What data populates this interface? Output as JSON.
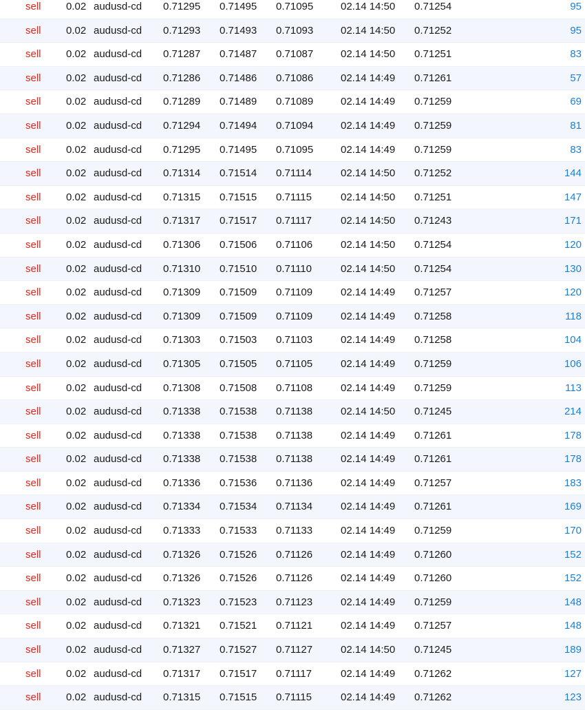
{
  "colors": {
    "sell_text": "#e0281e",
    "profit_text": "#1e7fd1",
    "row_alt_bg": "#f3f7fd",
    "row_bg": "#ffffff"
  },
  "orders": [
    {
      "side": "sell",
      "volume": "0.02",
      "symbol": "audusd-cd",
      "open_price": "0.71295",
      "take_profit": "0.71495",
      "stop_loss": "0.71095",
      "time": "02.14 14:50",
      "current_price": "0.71254",
      "profit": "95"
    },
    {
      "side": "sell",
      "volume": "0.02",
      "symbol": "audusd-cd",
      "open_price": "0.71293",
      "take_profit": "0.71493",
      "stop_loss": "0.71093",
      "time": "02.14 14:50",
      "current_price": "0.71252",
      "profit": "95"
    },
    {
      "side": "sell",
      "volume": "0.02",
      "symbol": "audusd-cd",
      "open_price": "0.71287",
      "take_profit": "0.71487",
      "stop_loss": "0.71087",
      "time": "02.14 14:50",
      "current_price": "0.71251",
      "profit": "83"
    },
    {
      "side": "sell",
      "volume": "0.02",
      "symbol": "audusd-cd",
      "open_price": "0.71286",
      "take_profit": "0.71486",
      "stop_loss": "0.71086",
      "time": "02.14 14:49",
      "current_price": "0.71261",
      "profit": "57"
    },
    {
      "side": "sell",
      "volume": "0.02",
      "symbol": "audusd-cd",
      "open_price": "0.71289",
      "take_profit": "0.71489",
      "stop_loss": "0.71089",
      "time": "02.14 14:49",
      "current_price": "0.71259",
      "profit": "69"
    },
    {
      "side": "sell",
      "volume": "0.02",
      "symbol": "audusd-cd",
      "open_price": "0.71294",
      "take_profit": "0.71494",
      "stop_loss": "0.71094",
      "time": "02.14 14:49",
      "current_price": "0.71259",
      "profit": "81"
    },
    {
      "side": "sell",
      "volume": "0.02",
      "symbol": "audusd-cd",
      "open_price": "0.71295",
      "take_profit": "0.71495",
      "stop_loss": "0.71095",
      "time": "02.14 14:49",
      "current_price": "0.71259",
      "profit": "83"
    },
    {
      "side": "sell",
      "volume": "0.02",
      "symbol": "audusd-cd",
      "open_price": "0.71314",
      "take_profit": "0.71514",
      "stop_loss": "0.71114",
      "time": "02.14 14:50",
      "current_price": "0.71252",
      "profit": "144"
    },
    {
      "side": "sell",
      "volume": "0.02",
      "symbol": "audusd-cd",
      "open_price": "0.71315",
      "take_profit": "0.71515",
      "stop_loss": "0.71115",
      "time": "02.14 14:50",
      "current_price": "0.71251",
      "profit": "147"
    },
    {
      "side": "sell",
      "volume": "0.02",
      "symbol": "audusd-cd",
      "open_price": "0.71317",
      "take_profit": "0.71517",
      "stop_loss": "0.71117",
      "time": "02.14 14:50",
      "current_price": "0.71243",
      "profit": "171"
    },
    {
      "side": "sell",
      "volume": "0.02",
      "symbol": "audusd-cd",
      "open_price": "0.71306",
      "take_profit": "0.71506",
      "stop_loss": "0.71106",
      "time": "02.14 14:50",
      "current_price": "0.71254",
      "profit": "120"
    },
    {
      "side": "sell",
      "volume": "0.02",
      "symbol": "audusd-cd",
      "open_price": "0.71310",
      "take_profit": "0.71510",
      "stop_loss": "0.71110",
      "time": "02.14 14:50",
      "current_price": "0.71254",
      "profit": "130"
    },
    {
      "side": "sell",
      "volume": "0.02",
      "symbol": "audusd-cd",
      "open_price": "0.71309",
      "take_profit": "0.71509",
      "stop_loss": "0.71109",
      "time": "02.14 14:49",
      "current_price": "0.71257",
      "profit": "120"
    },
    {
      "side": "sell",
      "volume": "0.02",
      "symbol": "audusd-cd",
      "open_price": "0.71309",
      "take_profit": "0.71509",
      "stop_loss": "0.71109",
      "time": "02.14 14:49",
      "current_price": "0.71258",
      "profit": "118"
    },
    {
      "side": "sell",
      "volume": "0.02",
      "symbol": "audusd-cd",
      "open_price": "0.71303",
      "take_profit": "0.71503",
      "stop_loss": "0.71103",
      "time": "02.14 14:49",
      "current_price": "0.71258",
      "profit": "104"
    },
    {
      "side": "sell",
      "volume": "0.02",
      "symbol": "audusd-cd",
      "open_price": "0.71305",
      "take_profit": "0.71505",
      "stop_loss": "0.71105",
      "time": "02.14 14:49",
      "current_price": "0.71259",
      "profit": "106"
    },
    {
      "side": "sell",
      "volume": "0.02",
      "symbol": "audusd-cd",
      "open_price": "0.71308",
      "take_profit": "0.71508",
      "stop_loss": "0.71108",
      "time": "02.14 14:49",
      "current_price": "0.71259",
      "profit": "113"
    },
    {
      "side": "sell",
      "volume": "0.02",
      "symbol": "audusd-cd",
      "open_price": "0.71338",
      "take_profit": "0.71538",
      "stop_loss": "0.71138",
      "time": "02.14 14:50",
      "current_price": "0.71245",
      "profit": "214"
    },
    {
      "side": "sell",
      "volume": "0.02",
      "symbol": "audusd-cd",
      "open_price": "0.71338",
      "take_profit": "0.71538",
      "stop_loss": "0.71138",
      "time": "02.14 14:49",
      "current_price": "0.71261",
      "profit": "178"
    },
    {
      "side": "sell",
      "volume": "0.02",
      "symbol": "audusd-cd",
      "open_price": "0.71338",
      "take_profit": "0.71538",
      "stop_loss": "0.71138",
      "time": "02.14 14:49",
      "current_price": "0.71261",
      "profit": "178"
    },
    {
      "side": "sell",
      "volume": "0.02",
      "symbol": "audusd-cd",
      "open_price": "0.71336",
      "take_profit": "0.71536",
      "stop_loss": "0.71136",
      "time": "02.14 14:49",
      "current_price": "0.71257",
      "profit": "183"
    },
    {
      "side": "sell",
      "volume": "0.02",
      "symbol": "audusd-cd",
      "open_price": "0.71334",
      "take_profit": "0.71534",
      "stop_loss": "0.71134",
      "time": "02.14 14:49",
      "current_price": "0.71261",
      "profit": "169"
    },
    {
      "side": "sell",
      "volume": "0.02",
      "symbol": "audusd-cd",
      "open_price": "0.71333",
      "take_profit": "0.71533",
      "stop_loss": "0.71133",
      "time": "02.14 14:49",
      "current_price": "0.71259",
      "profit": "170"
    },
    {
      "side": "sell",
      "volume": "0.02",
      "symbol": "audusd-cd",
      "open_price": "0.71326",
      "take_profit": "0.71526",
      "stop_loss": "0.71126",
      "time": "02.14 14:49",
      "current_price": "0.71260",
      "profit": "152"
    },
    {
      "side": "sell",
      "volume": "0.02",
      "symbol": "audusd-cd",
      "open_price": "0.71326",
      "take_profit": "0.71526",
      "stop_loss": "0.71126",
      "time": "02.14 14:49",
      "current_price": "0.71260",
      "profit": "152"
    },
    {
      "side": "sell",
      "volume": "0.02",
      "symbol": "audusd-cd",
      "open_price": "0.71323",
      "take_profit": "0.71523",
      "stop_loss": "0.71123",
      "time": "02.14 14:49",
      "current_price": "0.71259",
      "profit": "148"
    },
    {
      "side": "sell",
      "volume": "0.02",
      "symbol": "audusd-cd",
      "open_price": "0.71321",
      "take_profit": "0.71521",
      "stop_loss": "0.71121",
      "time": "02.14 14:49",
      "current_price": "0.71257",
      "profit": "148"
    },
    {
      "side": "sell",
      "volume": "0.02",
      "symbol": "audusd-cd",
      "open_price": "0.71327",
      "take_profit": "0.71527",
      "stop_loss": "0.71127",
      "time": "02.14 14:50",
      "current_price": "0.71245",
      "profit": "189"
    },
    {
      "side": "sell",
      "volume": "0.02",
      "symbol": "audusd-cd",
      "open_price": "0.71317",
      "take_profit": "0.71517",
      "stop_loss": "0.71117",
      "time": "02.14 14:49",
      "current_price": "0.71262",
      "profit": "127"
    },
    {
      "side": "sell",
      "volume": "0.02",
      "symbol": "audusd-cd",
      "open_price": "0.71315",
      "take_profit": "0.71515",
      "stop_loss": "0.71115",
      "time": "02.14 14:49",
      "current_price": "0.71262",
      "profit": "123"
    }
  ]
}
